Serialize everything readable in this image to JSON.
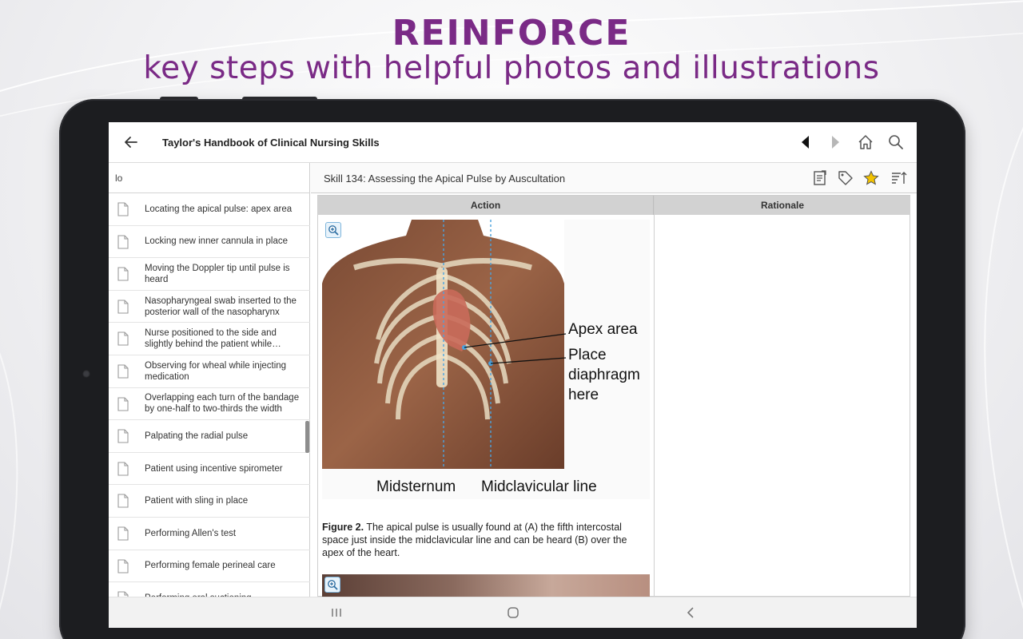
{
  "banner": {
    "headline": "REINFORCE",
    "subheadline": "key steps with helpful photos and illustrations"
  },
  "colors": {
    "brand_purple": "#7a2a86",
    "star_yellow": "#f2c200",
    "dotted_line_blue": "#4aa3df"
  },
  "appbar": {
    "back_icon": "arrow-left-icon",
    "title": "Taylor's Handbook of Clinical Nursing Skills",
    "prev_icon": "triangle-left-icon",
    "next_icon": "triangle-right-icon",
    "home_icon": "home-icon",
    "search_icon": "search-icon"
  },
  "sidebar": {
    "filter_value": "lo",
    "items": [
      {
        "label": "Locating the apical pulse: apex area"
      },
      {
        "label": "Locking new inner cannula in place"
      },
      {
        "label": "Moving the Doppler tip until pulse is heard"
      },
      {
        "label": "Nasopharyngeal swab inserted to the posterior wall of the nasopharynx"
      },
      {
        "label": "Nurse positioned to the side and slightly behind the patient while walking"
      },
      {
        "label": "Observing for wheal while injecting medication"
      },
      {
        "label": "Overlapping each turn of the bandage by one-half to two-thirds the width"
      },
      {
        "label": "Palpating the radial pulse"
      },
      {
        "label": "Patient using incentive spirometer"
      },
      {
        "label": "Patient with sling in place"
      },
      {
        "label": "Performing Allen's test"
      },
      {
        "label": "Performing female perineal care"
      },
      {
        "label": "Performing oral suctioning"
      }
    ]
  },
  "content": {
    "skill_title": "Skill 134: Assessing the Apical Pulse by Auscultation",
    "toolbar_icons": [
      "notes-icon",
      "tag-icon",
      "star-icon",
      "sort-icon"
    ],
    "table": {
      "headers": [
        "Action",
        "Rationale"
      ]
    },
    "figure": {
      "callout_apex": "Apex area",
      "callout_place_1": "Place",
      "callout_place_2": "diaphragm",
      "callout_place_3": "here",
      "label_midsternum": "Midsternum",
      "label_midclavicular": "Midclavicular line",
      "caption_bold": "Figure 2.",
      "caption_text": " The apical pulse is usually found at (A) the fifth intercostal space just inside the midclavicular line and can be heard (B) over the apex of the heart."
    }
  },
  "system_nav": {
    "recents_icon": "recents-icon",
    "home_icon": "home-circle-icon",
    "back_icon": "chevron-left-icon"
  }
}
